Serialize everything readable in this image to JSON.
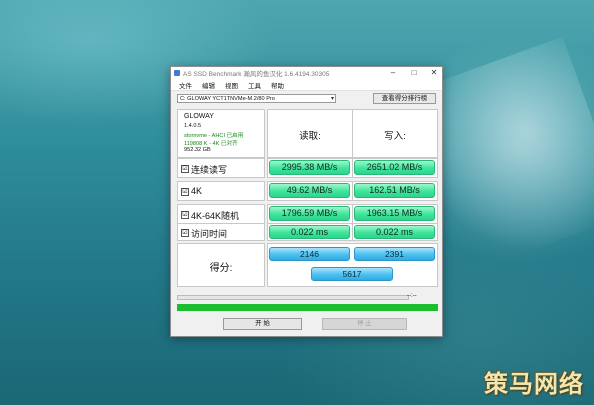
{
  "window": {
    "title": "AS SSD Benchmark 瀚风的鱼汉化 1.6.4194.30305",
    "minimize_glyph": "–",
    "maximize_glyph": "□",
    "close_glyph": "✕"
  },
  "menu": [
    "文件",
    "编辑",
    "视图",
    "工具",
    "帮助"
  ],
  "drive_select": {
    "value": "C: GLOWAY YCT1TNVMe-M.2/80 Pro",
    "arrow": "▾"
  },
  "compress_button": "查看得分排行榜",
  "info": {
    "model": "GLOWAY",
    "firmware": "1.4.0.5",
    "driver": "stornvme - AHCI 已启用",
    "alignment": "119808 K - 4K 已对齐",
    "capacity": "952.32 GB"
  },
  "headers": {
    "read": "读取:",
    "write": "写入:"
  },
  "rows": [
    {
      "label": "连续读写",
      "read": "2995.38 MB/s",
      "write": "2651.02 MB/s"
    },
    {
      "label": "4K",
      "read": "49.62 MB/s",
      "write": "162.51 MB/s"
    },
    {
      "label": "4K-64K随机",
      "read": "1796.59 MB/s",
      "write": "1963.15 MB/s"
    },
    {
      "label": "访问时间",
      "read": "0.022 ms",
      "write": "0.022 ms"
    }
  ],
  "checkbox_glyph": "☑",
  "score": {
    "label": "得分:",
    "read": "2146",
    "write": "2391",
    "total": "5617"
  },
  "progress": {
    "timer": "--:--",
    "level": 0
  },
  "status_bar": {
    "level": 1.0
  },
  "buttons": {
    "start": "开 始",
    "stop": "停 止"
  },
  "watermark": "策马网络",
  "colors": {
    "value_green": "#3ee59c",
    "score_blue": "#4cc0f0",
    "status_green": "#1cbd2e"
  }
}
